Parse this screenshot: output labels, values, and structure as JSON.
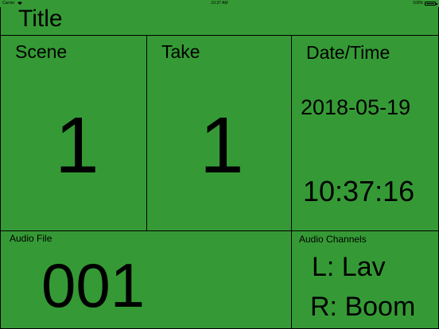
{
  "status_bar": {
    "carrier": "Carrier",
    "time": "10:37 AM",
    "battery": "100%"
  },
  "title": "Title",
  "scene": {
    "label": "Scene",
    "value": "1"
  },
  "take": {
    "label": "Take",
    "value": "1"
  },
  "datetime": {
    "label": "Date/Time",
    "date": "2018-05-19",
    "time": "10:37:16"
  },
  "audio_file": {
    "label": "Audio File",
    "value": "001"
  },
  "audio_channels": {
    "label": "Audio Channels",
    "left": "L: Lav",
    "right": "R: Boom"
  },
  "colors": {
    "background": "#359a35",
    "text": "#000000"
  }
}
